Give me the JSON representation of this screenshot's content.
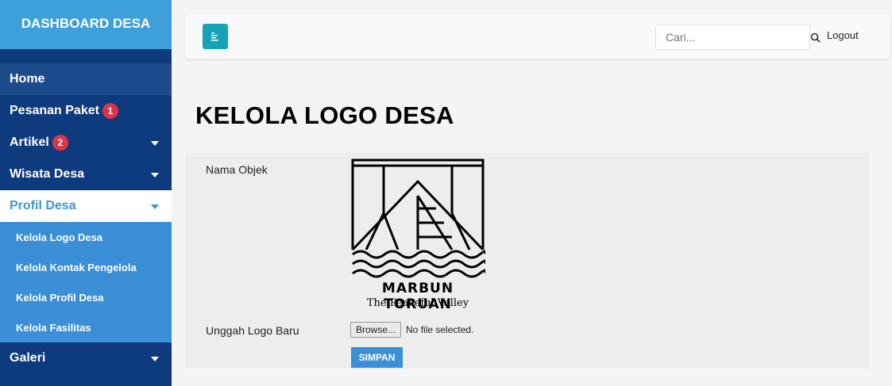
{
  "sidebar": {
    "brand": "DASHBOARD DESA",
    "items": [
      {
        "label": "Home"
      },
      {
        "label": "Pesanan Paket",
        "badge": "1"
      },
      {
        "label": "Artikel",
        "badge": "2"
      },
      {
        "label": "Wisata Desa"
      },
      {
        "label": "Profil Desa"
      },
      {
        "label": "Galeri"
      }
    ],
    "submenu": [
      {
        "label": "Kelola Logo Desa"
      },
      {
        "label": "Kelola Kontak Pengelola"
      },
      {
        "label": "Kelola Profil Desa"
      },
      {
        "label": "Kelola Fasilitas"
      }
    ]
  },
  "topbar": {
    "search_placeholder": "Cari...",
    "logout_label": "Logout"
  },
  "main": {
    "title": "KELOLA LOGO DESA",
    "form": {
      "name_label": "Nama Objek",
      "upload_label": "Unggah Logo Baru",
      "browse_label": "Browse...",
      "file_status": "No file selected.",
      "save_label": "SIMPAN"
    },
    "logo": {
      "title": "MARBUN TORUAN",
      "subtitle": "The Peaceful Valley"
    }
  },
  "colors": {
    "sidebar_bg": "#0e3a7e",
    "brand_bg": "#3ea0db",
    "submenu_bg": "#3a8fd6",
    "toggle_btn": "#17a2b8",
    "badge": "#dc3545"
  },
  "icons": {
    "toggle": "align-left-icon",
    "search": "search-icon",
    "caret": "caret-down-icon"
  }
}
